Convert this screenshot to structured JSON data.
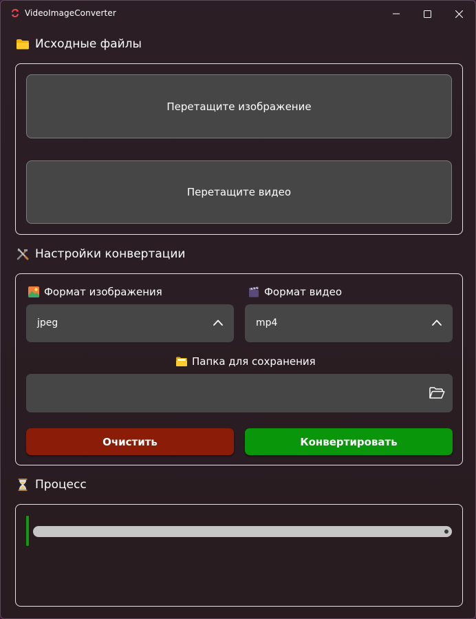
{
  "window": {
    "title": "VideoImageConverter"
  },
  "source_section": {
    "title": "Исходные файлы",
    "icon": "folder-icon",
    "image_drop_label": "Перетащите изображение",
    "video_drop_label": "Перетащите видео"
  },
  "settings_section": {
    "title": "Настройки конвертации",
    "icon": "tools-icon",
    "image_format": {
      "label": "Формат изображения",
      "icon": "picture-icon",
      "value": "jpeg"
    },
    "video_format": {
      "label": "Формат видео",
      "icon": "clapper-icon",
      "value": "mp4"
    },
    "save_folder": {
      "label": "Папка для сохранения",
      "icon": "open-folder-icon",
      "value": ""
    },
    "clear_button": "Очистить",
    "convert_button": "Конвертировать"
  },
  "process_section": {
    "title": "Процесс",
    "icon": "hourglass-icon",
    "progress": 0
  },
  "colors": {
    "clear_button": "#8b1c07",
    "convert_button": "#0a960a",
    "progress_marker": "#0f9a0f"
  }
}
